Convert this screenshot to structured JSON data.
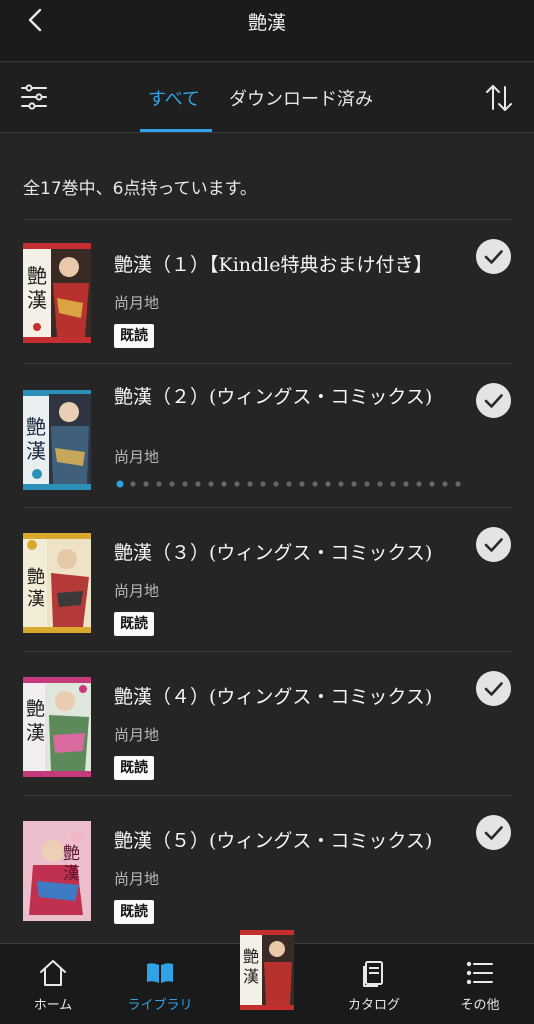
{
  "header": {
    "title": "艶漢"
  },
  "tabs": {
    "all_label": "すべて",
    "downloaded_label": "ダウンロード済み"
  },
  "colors": {
    "accent": "#2fa3e6",
    "background": "#252525"
  },
  "summary": "全17巻中、6点持っています。",
  "books": [
    {
      "title": "艶漢（１）【Kindle特典おまけ付き】",
      "author": "尚月地",
      "badge": "既読",
      "checked": true
    },
    {
      "title": "艶漢（２）(ウィングス・コミックス)",
      "author": "尚月地",
      "badge": "",
      "checked": true,
      "reading_progress": 0.04
    },
    {
      "title": "艶漢（３）(ウィングス・コミックス)",
      "author": "尚月地",
      "badge": "既読",
      "checked": true
    },
    {
      "title": "艶漢（４）(ウィングス・コミックス)",
      "author": "尚月地",
      "badge": "既読",
      "checked": true
    },
    {
      "title": "艶漢（５）(ウィングス・コミックス)",
      "author": "尚月地",
      "badge": "既読",
      "checked": true
    }
  ],
  "nav": {
    "home": "ホーム",
    "library": "ライブラリ",
    "catalog": "カタログ",
    "more": "その他"
  }
}
